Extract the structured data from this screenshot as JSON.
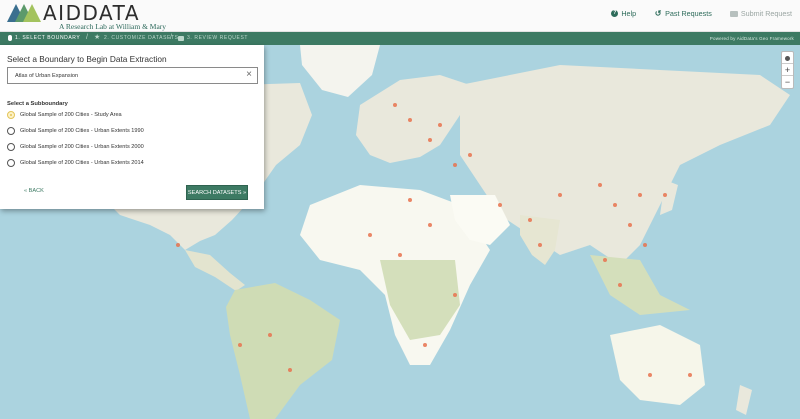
{
  "header": {
    "logo_text": "AIDDATA",
    "logo_sub": "A Research Lab at William & Mary",
    "nav": [
      {
        "label": "Help",
        "icon": "help-icon"
      },
      {
        "label": "Past Requests",
        "icon": "history-icon"
      },
      {
        "label": "Submit Request",
        "icon": "list-icon"
      }
    ]
  },
  "steps": {
    "step1": "1. SELECT BOUNDARY",
    "step2": "2. CUSTOMIZE DATASETS",
    "step3": "3. REVIEW REQUEST",
    "powered": "Powered by AidData's Geo Framework"
  },
  "panel": {
    "title": "Select a Boundary to Begin Data Extraction",
    "boundary_value": "Atlas of Urban Expansion",
    "subboundary_label": "Select a Subboundary",
    "options": [
      "Global Sample of 200 Cities - Study Area",
      "Global Sample of 200 Cities - Urban Extents 1990",
      "Global Sample of 200 Cities - Urban Extents 2000",
      "Global Sample of 200 Cities - Urban Extents 2014"
    ],
    "back_label": "« BACK",
    "search_label": "SEARCH DATASETS »"
  },
  "colors": {
    "accent": "#3d7a63",
    "ocean": "#abd3df",
    "land": "#eeece2",
    "desert": "#fbfbf4",
    "forest": "#c8d9b2",
    "marker": "#e8734f"
  }
}
